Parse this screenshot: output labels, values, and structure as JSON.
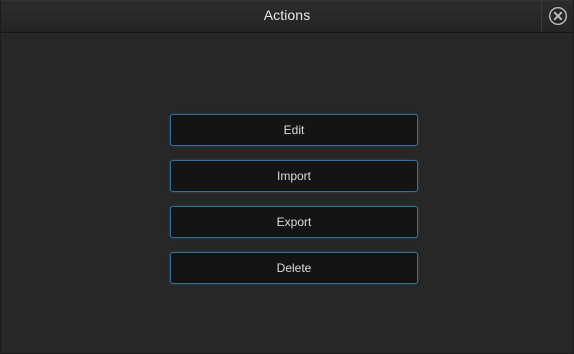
{
  "dialog": {
    "title": "Actions",
    "close_icon": "close-circle-x-icon"
  },
  "actions": [
    {
      "label": "Edit"
    },
    {
      "label": "Import"
    },
    {
      "label": "Export"
    },
    {
      "label": "Delete"
    }
  ],
  "colors": {
    "background": "#272727",
    "button_background": "#141414",
    "button_border": "#2f6f9b",
    "text": "#dcdcdc"
  }
}
